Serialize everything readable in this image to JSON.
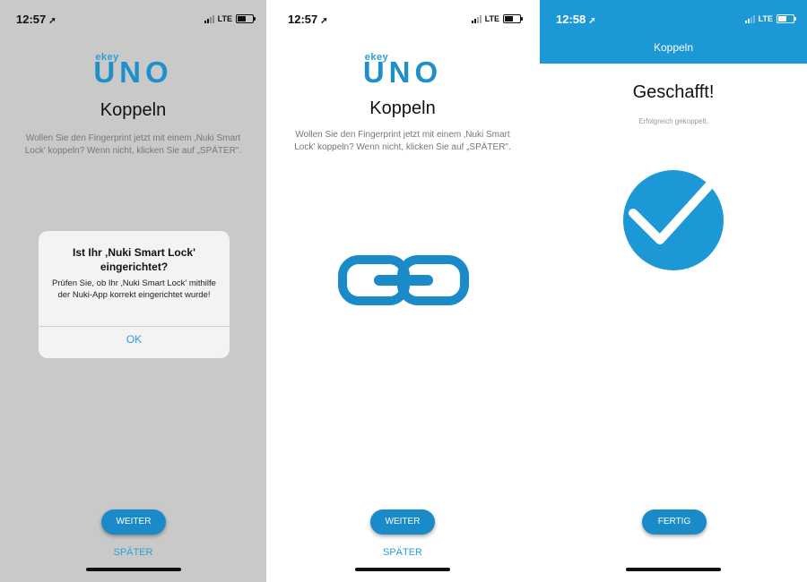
{
  "colors": {
    "accent": "#1d98d7",
    "button": "#1a8ac9",
    "gray_bg": "#c9c9c9"
  },
  "screen1": {
    "status": {
      "time": "12:57",
      "network": "LTE"
    },
    "logo": {
      "small": "ekey",
      "big": "UNO"
    },
    "title": "Koppeln",
    "description": "Wollen Sie den Fingerprint jetzt mit einem ‚Nuki Smart Lock' koppeln? Wenn nicht, klicken Sie auf „SPÄTER\".",
    "dialog": {
      "title": "Ist Ihr ‚Nuki Smart Lock' eingerichtet?",
      "message": "Prüfen Sie, ob Ihr ‚Nuki Smart Lock' mithilfe der Nuki-App korrekt eingerichtet wurde!",
      "ok": "OK"
    },
    "primary_button": "WEITER",
    "later_link": "SPÄTER"
  },
  "screen2": {
    "status": {
      "time": "12:57",
      "network": "LTE"
    },
    "logo": {
      "small": "ekey",
      "big": "UNO"
    },
    "title": "Koppeln",
    "description": "Wollen Sie den Fingerprint jetzt mit einem ‚Nuki Smart Lock' koppeln? Wenn nicht, klicken Sie auf „SPÄTER\".",
    "icon": "chain-link-icon",
    "primary_button": "WEITER",
    "later_link": "SPÄTER"
  },
  "screen3": {
    "status": {
      "time": "12:58",
      "network": "LTE"
    },
    "nav_title": "Koppeln",
    "title": "Geschafft!",
    "subtitle": "Erfolgreich gekoppelt.",
    "icon": "checkmark-icon",
    "primary_button": "FERTIG"
  }
}
